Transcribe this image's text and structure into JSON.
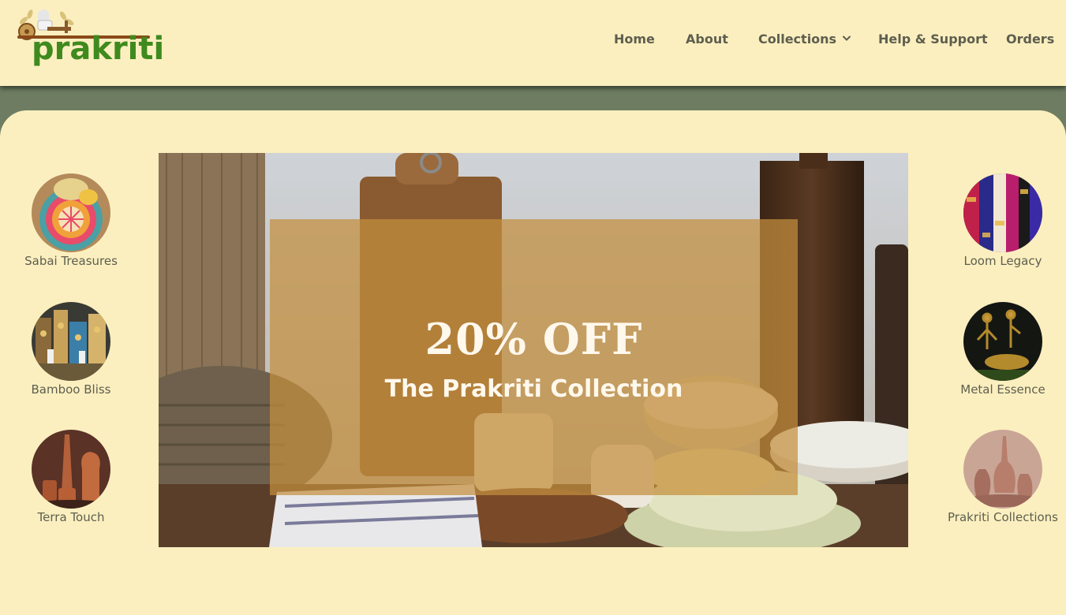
{
  "brand": {
    "name": "prakriti",
    "color": "#3f8a1e"
  },
  "nav": {
    "items": [
      {
        "label": "Home"
      },
      {
        "label": "About"
      },
      {
        "label": "Collections",
        "icon": "chevron-down-icon"
      },
      {
        "label": "Help & Support"
      },
      {
        "label": "Orders"
      }
    ]
  },
  "categories": {
    "left": [
      {
        "label": "Sabai Treasures"
      },
      {
        "label": "Bamboo Bliss"
      },
      {
        "label": "Terra Touch"
      }
    ],
    "right": [
      {
        "label": "Loom Legacy"
      },
      {
        "label": "Metal Essence"
      },
      {
        "label": "Prakriti Collections"
      }
    ]
  },
  "banner": {
    "title": "20% OFF",
    "subtitle": "The Prakriti Collection"
  },
  "colors": {
    "background": "#fbefbf",
    "stripe": "#6e7d62",
    "nav_text": "#5e5e4f",
    "overlay": "#c48f3e"
  }
}
